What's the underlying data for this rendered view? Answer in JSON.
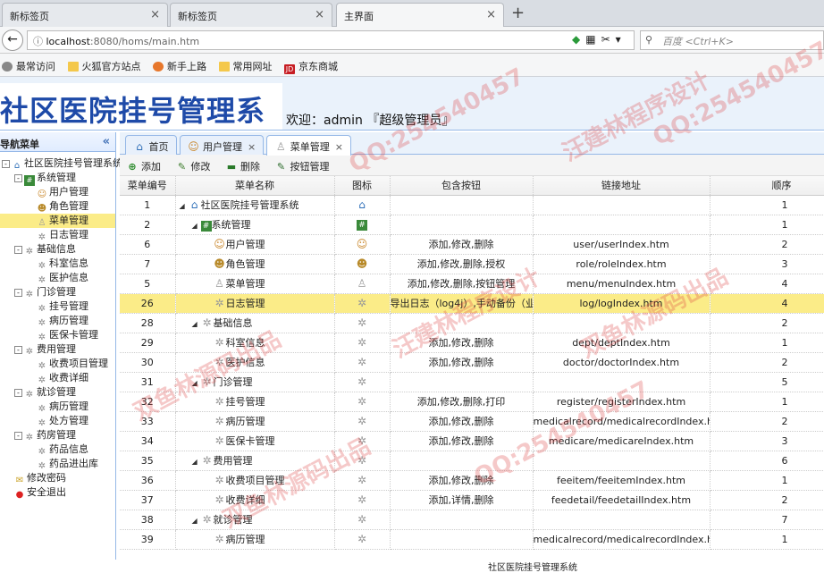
{
  "browser": {
    "tabs": [
      {
        "label": "新标签页",
        "close": "×"
      },
      {
        "label": "新标签页",
        "close": "×"
      },
      {
        "label": "主界面",
        "close": "×"
      }
    ],
    "new_tab": "+",
    "url_host": "localhost",
    "url_path": ":8080/homs/main.htm",
    "search_placeholder": "百度 <Ctrl+K>",
    "bookmarks": [
      "最常访问",
      "火狐官方站点",
      "新手上路",
      "常用网址",
      "京东商城"
    ]
  },
  "app": {
    "title": "社区医院挂号管理系统",
    "welcome": "欢迎：admin 『超级管理员』",
    "footer": "社区医院挂号管理系统"
  },
  "sidebar": {
    "header": "导航菜单",
    "collapse": "«",
    "tree": [
      {
        "label": "社区医院挂号管理系统",
        "level": 0,
        "toggle": "-",
        "icon": "home"
      },
      {
        "label": "系统管理",
        "level": 1,
        "toggle": "-",
        "icon": "sys"
      },
      {
        "label": "用户管理",
        "level": 2,
        "icon": "user"
      },
      {
        "label": "角色管理",
        "level": 2,
        "icon": "role"
      },
      {
        "label": "菜单管理",
        "level": 2,
        "icon": "menu",
        "selected": true
      },
      {
        "label": "日志管理",
        "level": 2,
        "icon": "gear"
      },
      {
        "label": "基础信息",
        "level": 1,
        "toggle": "-",
        "icon": "gear"
      },
      {
        "label": "科室信息",
        "level": 2,
        "icon": "gear"
      },
      {
        "label": "医护信息",
        "level": 2,
        "icon": "gear"
      },
      {
        "label": "门诊管理",
        "level": 1,
        "toggle": "-",
        "icon": "gear"
      },
      {
        "label": "挂号管理",
        "level": 2,
        "icon": "gear"
      },
      {
        "label": "病历管理",
        "level": 2,
        "icon": "gear"
      },
      {
        "label": "医保卡管理",
        "level": 2,
        "icon": "gear"
      },
      {
        "label": "费用管理",
        "level": 1,
        "toggle": "-",
        "icon": "gear"
      },
      {
        "label": "收费项目管理",
        "level": 2,
        "icon": "gear"
      },
      {
        "label": "收费详细",
        "level": 2,
        "icon": "gear"
      },
      {
        "label": "就诊管理",
        "level": 1,
        "toggle": "-",
        "icon": "gear"
      },
      {
        "label": "病历管理",
        "level": 2,
        "icon": "gear"
      },
      {
        "label": "处方管理",
        "level": 2,
        "icon": "gear"
      },
      {
        "label": "药房管理",
        "level": 1,
        "toggle": "-",
        "icon": "gear"
      },
      {
        "label": "药品信息",
        "level": 2,
        "icon": "gear"
      },
      {
        "label": "药品进出库",
        "level": 2,
        "icon": "gear"
      },
      {
        "label": "修改密码",
        "level": 1,
        "icon": "key"
      },
      {
        "label": "安全退出",
        "level": 1,
        "icon": "exit"
      }
    ]
  },
  "page_tabs": [
    {
      "label": "首页",
      "icon": "home"
    },
    {
      "label": "用户管理",
      "icon": "user",
      "close": "×"
    },
    {
      "label": "菜单管理",
      "icon": "menu",
      "close": "×",
      "active": true
    }
  ],
  "toolbar": {
    "add": "添加",
    "edit": "修改",
    "delete": "删除",
    "button_mgmt": "按钮管理"
  },
  "table": {
    "columns": [
      "菜单编号",
      "菜单名称",
      "图标",
      "包含按钮",
      "链接地址",
      "顺序"
    ],
    "rows": [
      {
        "id": "1",
        "name": "社区医院挂号管理系统",
        "level": 0,
        "expand": true,
        "icon": "home",
        "buttons": "",
        "url": "",
        "order": "1"
      },
      {
        "id": "2",
        "name": "系统管理",
        "level": 1,
        "expand": true,
        "icon": "sys",
        "buttons": "",
        "url": "",
        "order": "1"
      },
      {
        "id": "6",
        "name": "用户管理",
        "level": 2,
        "icon": "user",
        "buttons": "添加,修改,删除",
        "url": "user/userIndex.htm",
        "order": "2"
      },
      {
        "id": "7",
        "name": "角色管理",
        "level": 2,
        "icon": "role",
        "buttons": "添加,修改,删除,授权",
        "url": "role/roleIndex.htm",
        "order": "3"
      },
      {
        "id": "5",
        "name": "菜单管理",
        "level": 2,
        "icon": "menu",
        "buttons": "添加,修改,删除,按钮管理",
        "url": "menu/menuIndex.htm",
        "order": "4"
      },
      {
        "id": "26",
        "name": "日志管理",
        "level": 2,
        "icon": "gear",
        "buttons": "导出日志（log4j）,手动备份（业",
        "url": "log/logIndex.htm",
        "order": "4",
        "selected": true
      },
      {
        "id": "28",
        "name": "基础信息",
        "level": 1,
        "expand": true,
        "icon": "gear",
        "buttons": "",
        "url": "",
        "order": "2"
      },
      {
        "id": "29",
        "name": "科室信息",
        "level": 2,
        "icon": "gear",
        "buttons": "添加,修改,删除",
        "url": "dept/deptIndex.htm",
        "order": "1"
      },
      {
        "id": "30",
        "name": "医护信息",
        "level": 2,
        "icon": "gear",
        "buttons": "添加,修改,删除",
        "url": "doctor/doctorIndex.htm",
        "order": "2"
      },
      {
        "id": "31",
        "name": "门诊管理",
        "level": 1,
        "expand": true,
        "icon": "gear",
        "buttons": "",
        "url": "",
        "order": "5"
      },
      {
        "id": "32",
        "name": "挂号管理",
        "level": 2,
        "icon": "gear",
        "buttons": "添加,修改,删除,打印",
        "url": "register/registerIndex.htm",
        "order": "1"
      },
      {
        "id": "33",
        "name": "病历管理",
        "level": 2,
        "icon": "gear",
        "buttons": "添加,修改,删除",
        "url": "medicalrecord/medicalrecordIndex.ht",
        "order": "2"
      },
      {
        "id": "34",
        "name": "医保卡管理",
        "level": 2,
        "icon": "gear",
        "buttons": "添加,修改,删除",
        "url": "medicare/medicareIndex.htm",
        "order": "3"
      },
      {
        "id": "35",
        "name": "费用管理",
        "level": 1,
        "expand": true,
        "icon": "gear",
        "buttons": "",
        "url": "",
        "order": "6"
      },
      {
        "id": "36",
        "name": "收费项目管理",
        "level": 2,
        "icon": "gear",
        "buttons": "添加,修改,删除",
        "url": "feeitem/feeitemIndex.htm",
        "order": "1"
      },
      {
        "id": "37",
        "name": "收费详细",
        "level": 2,
        "icon": "gear",
        "buttons": "添加,详情,删除",
        "url": "feedetail/feedetailIndex.htm",
        "order": "2"
      },
      {
        "id": "38",
        "name": "就诊管理",
        "level": 1,
        "expand": true,
        "icon": "gear",
        "buttons": "",
        "url": "",
        "order": "7"
      },
      {
        "id": "39",
        "name": "病历管理",
        "level": 2,
        "icon": "gear",
        "buttons": "",
        "url": "medicalrecord/medicalrecordIndex.ht",
        "order": "1"
      }
    ]
  },
  "watermarks": [
    "QQ:254540457",
    "汪建林程序设计",
    "双鱼林源码出品"
  ]
}
